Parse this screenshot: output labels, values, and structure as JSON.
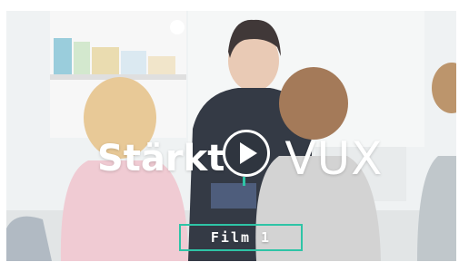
{
  "video": {
    "title_left": "Stärkt",
    "title_right": "VUX",
    "badge_label": "Film 1",
    "accent_color": "#2ec4a6",
    "play_icon": "play-icon"
  }
}
